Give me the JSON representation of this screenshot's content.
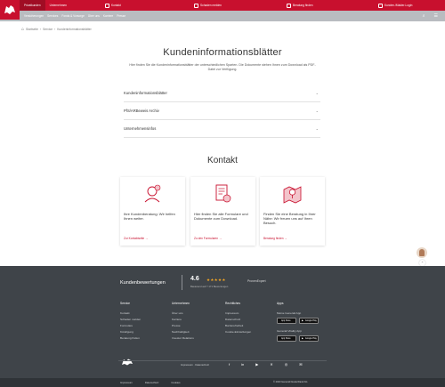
{
  "header": {
    "tabs": [
      "Privatkunden",
      "Unternehmen"
    ],
    "links": [
      "Kontakt",
      "Schaden melden",
      "Beratung finden",
      "Kunden-/Makler-Login"
    ],
    "nav_items": [
      "Versicherungen",
      "Services",
      "Fonds & Vorsorge",
      "Über uns",
      "Karriere",
      "Presse"
    ]
  },
  "breadcrumb": [
    "Startseite",
    "Service",
    "Kundeninformationsblätter"
  ],
  "main": {
    "title": "Kundeninformationsblätter",
    "intro": "Hier finden Sie die Kundeninformationsblätter der unterschiedlichen Sparten. Die Dokumente stehen Ihnen zum Download als PDF-Datei zur Verfügung.",
    "accordion": [
      "Kundeninformationsblätter",
      "PfS/ARBeweis Archiv",
      "Unternehmensinfos"
    ]
  },
  "contact": {
    "title": "Kontakt",
    "cards": [
      {
        "text": "Ihre Kundenberatung: Wir helfen Ihnen weiter.",
        "link": "Zur Kontaktseite →"
      },
      {
        "text": "Hier finden Sie alle Formulare und Dokumente zum Download.",
        "link": "Zu den Formularen →"
      },
      {
        "text": "Finden Sie eine Beratung in Ihrer Nähe: Wir freuen uns auf Ihren Besuch.",
        "link": "Beratung finden →"
      }
    ]
  },
  "footer": {
    "rating_label": "Kundenbewertungen",
    "score": "4.6",
    "stars": "★★★★★",
    "count": "Basierend auf 7.171 Bewertungen",
    "proven": "ProvenExpert",
    "columns": [
      {
        "heading": "Service",
        "links": [
          "Kontakt",
          "Schaden melden",
          "Formulare",
          "Kündigung",
          "Beratung finden"
        ]
      },
      {
        "heading": "Unternehmen",
        "links": [
          "Über uns",
          "Karriere",
          "Presse",
          "Nachhaltigkeit",
          "Investor Relations"
        ]
      },
      {
        "heading": "Rechtliches",
        "links": [
          "Impressum",
          "Datenschutz",
          "Barrierefreiheit",
          "Cookie-Einstellungen"
        ]
      },
      {
        "heading": "Apps",
        "links": [
          "Meine Generali App",
          "Generali Vitality App"
        ]
      }
    ],
    "stores": [
      "App Store",
      "Google Play"
    ],
    "legal": "Impressum · Datenschutz",
    "social": [
      "f",
      "in",
      "▶",
      "✕",
      "◎",
      "✉"
    ],
    "bottom_links": [
      "Impressum",
      "Datenschutz",
      "Cookies"
    ],
    "copyright": "© 2023 Generali Deutschland AG"
  },
  "colors": {
    "brand": "#c8102e",
    "footer": "#3f4449"
  }
}
